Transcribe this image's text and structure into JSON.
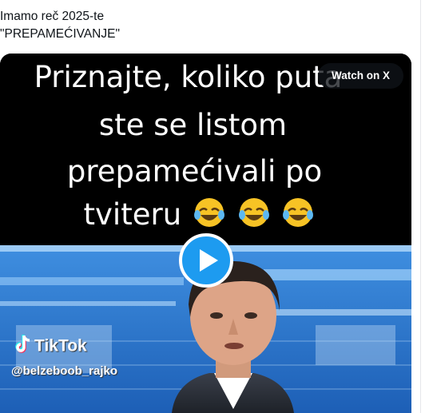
{
  "tweet": {
    "text_line1": "Imamo reč 2025-te",
    "text_line2": "\"PREPAMEĆIVANJE\""
  },
  "video": {
    "caption_lines": [
      "Priznajte, koliko puta",
      "ste se listom",
      "prepamećivali po",
      "tviteru"
    ],
    "watch_label": "Watch on X",
    "watermark_brand": "TikTok",
    "watermark_handle": "@belzeboob_rajko"
  },
  "colors": {
    "play_button": "#1d9bf0",
    "text_primary": "#0f1419",
    "divider": "#e5e7eb"
  },
  "icons": {
    "play": "play-icon",
    "emoji": "rolling-on-floor-laughing-emoji",
    "tiktok": "tiktok-logo-icon"
  }
}
